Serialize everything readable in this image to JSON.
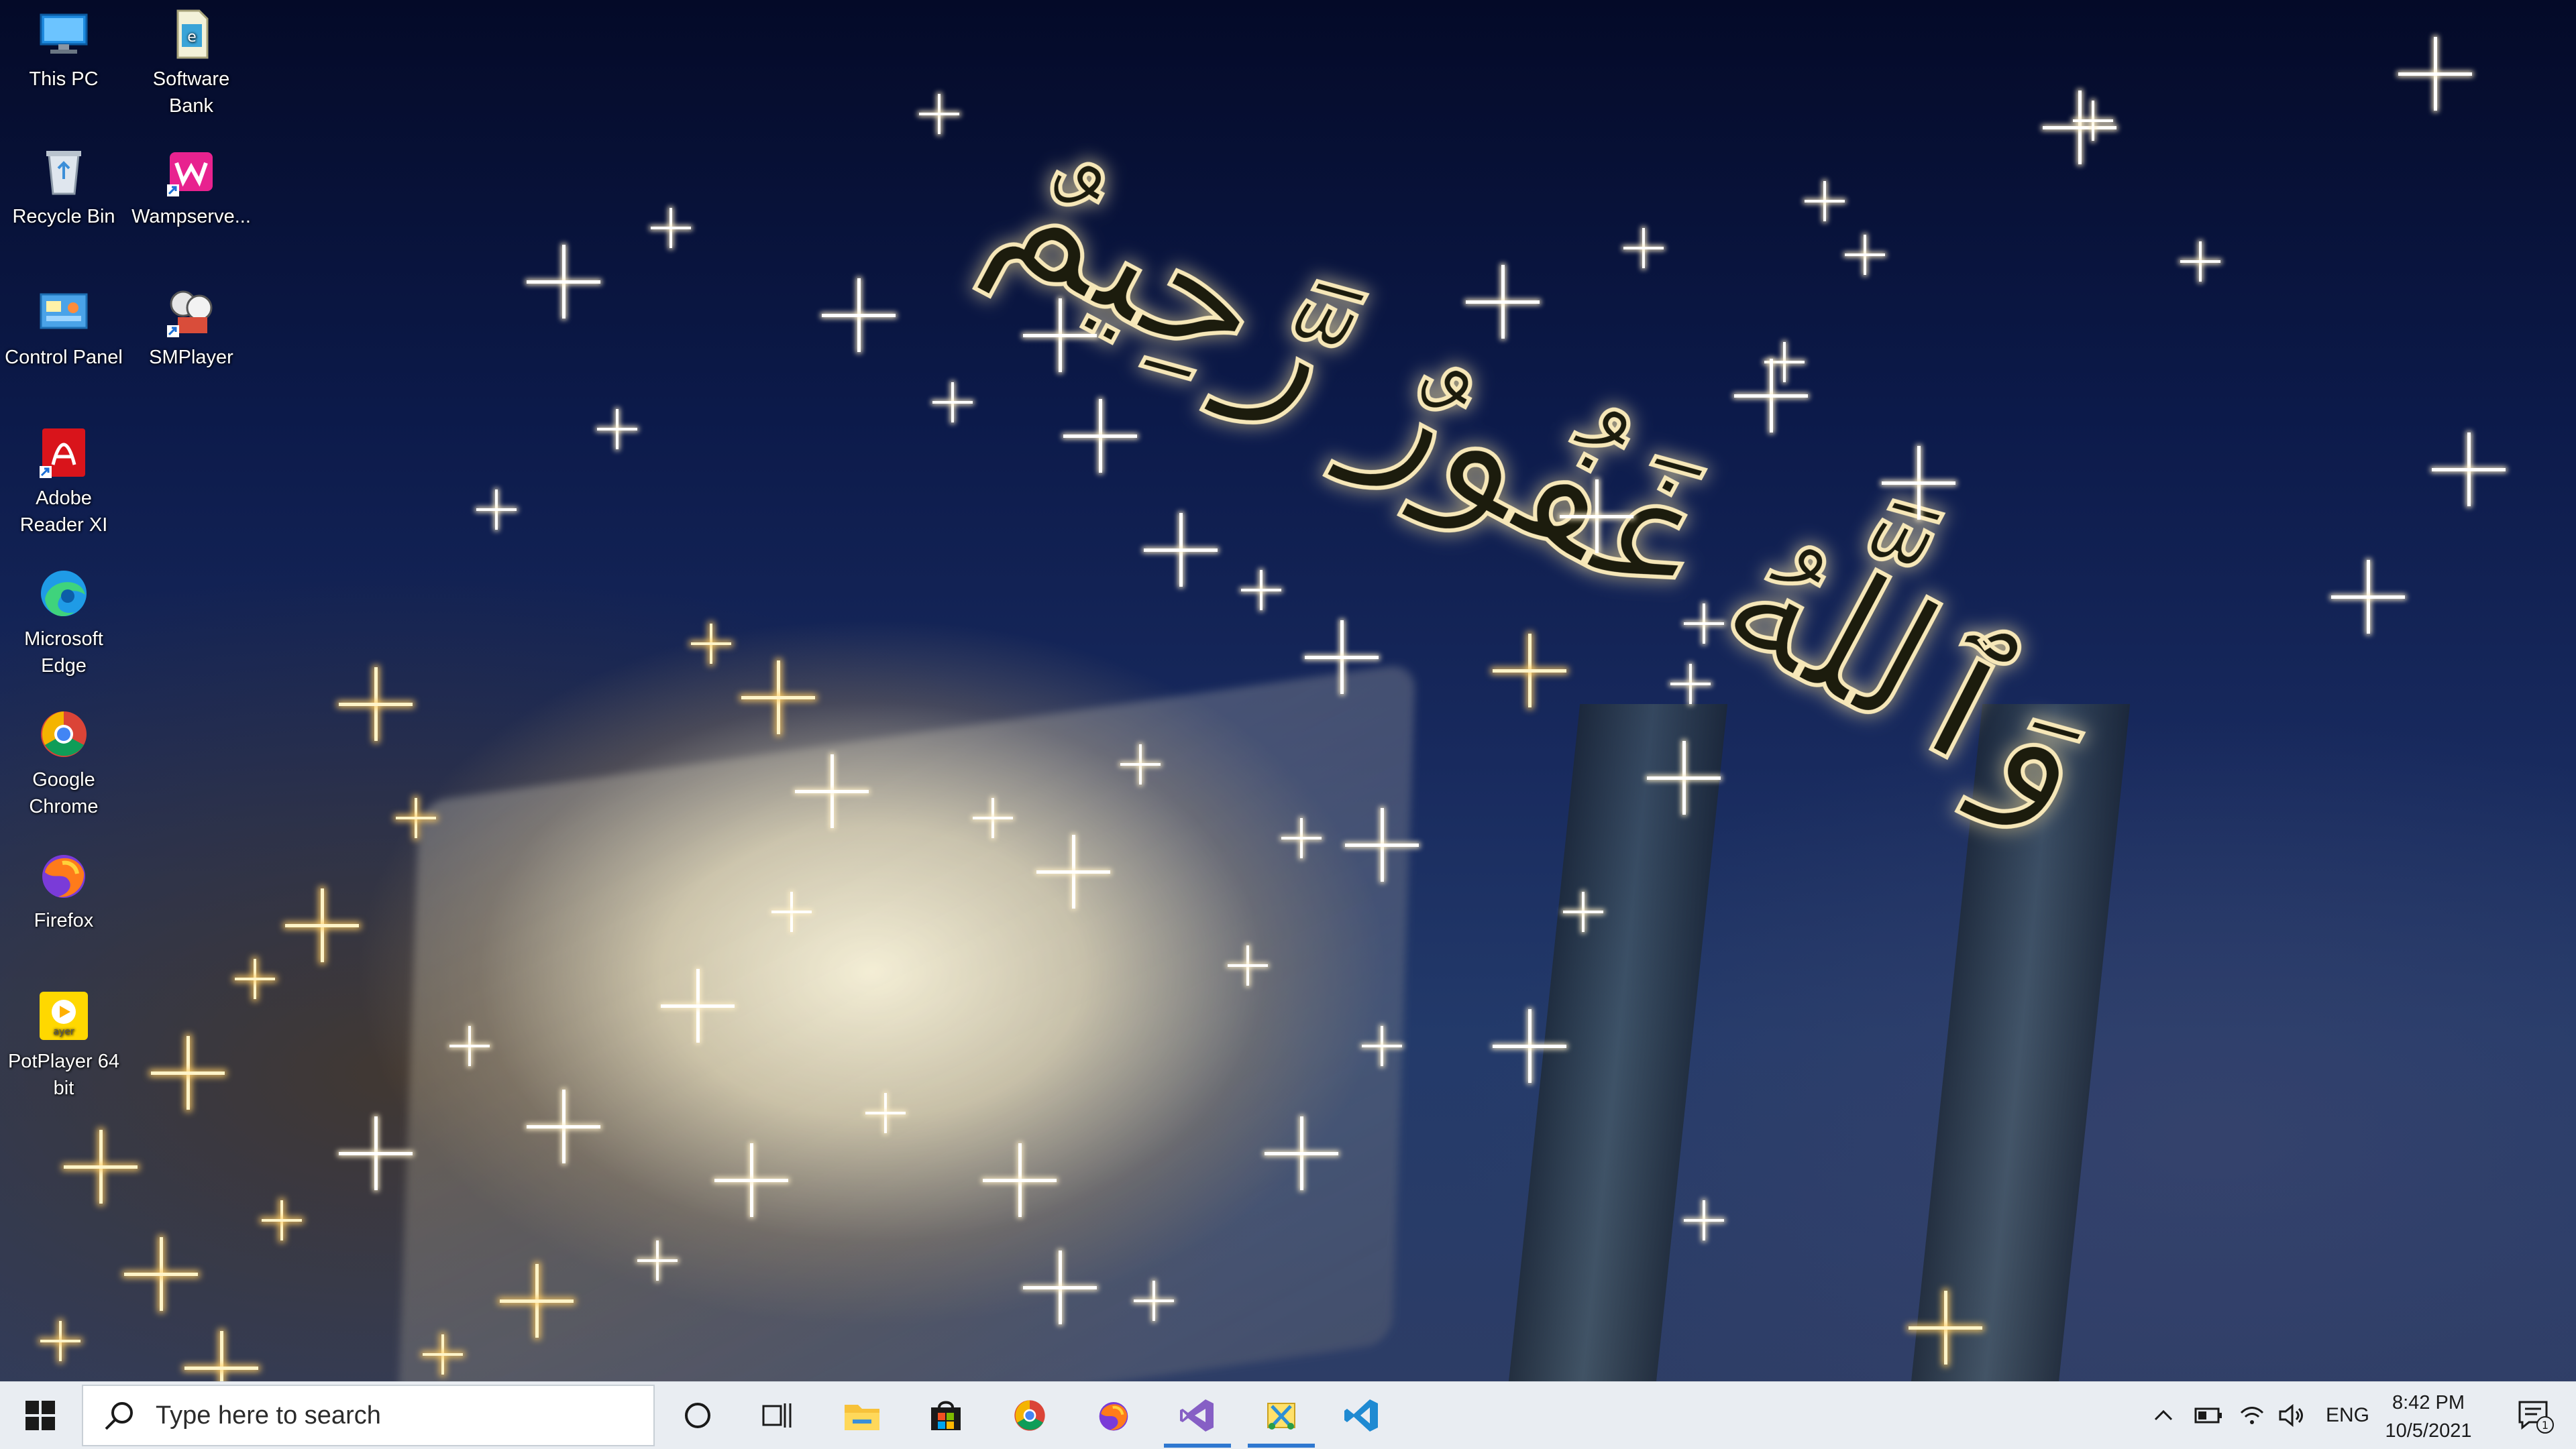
{
  "desktop": {
    "icons": [
      {
        "label": "This PC",
        "icon": "this-pc-icon"
      },
      {
        "label": "Software Bank",
        "icon": "software-bank-icon"
      },
      {
        "label": "Recycle Bin",
        "icon": "recycle-bin-icon"
      },
      {
        "label": "Wampserve...",
        "icon": "wampserver-icon"
      },
      {
        "label": "Control Panel",
        "icon": "control-panel-icon"
      },
      {
        "label": "SMPlayer",
        "icon": "smplayer-icon"
      },
      {
        "label": "Adobe Reader XI",
        "icon": "adobe-reader-icon"
      },
      {
        "label": "Microsoft Edge",
        "icon": "edge-icon"
      },
      {
        "label": "Google Chrome",
        "icon": "chrome-icon"
      },
      {
        "label": "Firefox",
        "icon": "firefox-icon"
      },
      {
        "label": "PotPlayer 64 bit",
        "icon": "potplayer-icon"
      }
    ],
    "wallpaper_calligraphy": "وَٱللَّهُ غَفُورٌ رَّحِيمٌ"
  },
  "taskbar": {
    "search_placeholder": "Type here to search",
    "apps": [
      {
        "name": "cortana",
        "icon": "cortana-icon"
      },
      {
        "name": "task-view",
        "icon": "task-view-icon"
      },
      {
        "name": "file-explorer",
        "icon": "file-explorer-icon"
      },
      {
        "name": "microsoft-store",
        "icon": "store-icon"
      },
      {
        "name": "google-chrome",
        "icon": "chrome-icon"
      },
      {
        "name": "firefox",
        "icon": "firefox-icon"
      },
      {
        "name": "visual-studio",
        "icon": "visual-studio-icon"
      },
      {
        "name": "snipping-tool",
        "icon": "snipping-tool-icon"
      },
      {
        "name": "vs-code",
        "icon": "vscode-icon"
      }
    ],
    "tray": {
      "language": "ENG",
      "time": "8:42 PM",
      "date": "10/5/2021",
      "notification_count": "1"
    }
  },
  "colors": {
    "taskbar_bg": "#e9edf2",
    "active_indicator": "#2f78d0"
  }
}
